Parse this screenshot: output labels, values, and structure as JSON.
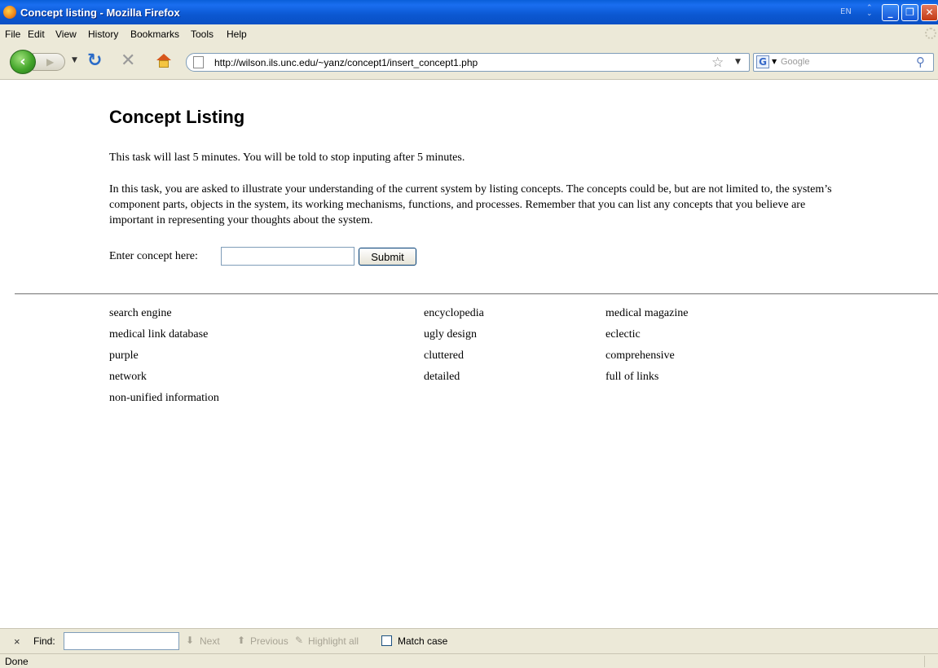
{
  "window": {
    "title": "Concept listing - Mozilla Firefox",
    "lang": "EN"
  },
  "menu": {
    "items": [
      "File",
      "Edit",
      "View",
      "History",
      "Bookmarks",
      "Tools",
      "Help"
    ]
  },
  "nav": {
    "url": "http://wilson.ils.unc.edu/~yanz/concept1/insert_concept1.php",
    "search_placeholder": "Google"
  },
  "page": {
    "heading": "Concept Listing",
    "para1": "This task will last 5 minutes. You will be told to stop inputing after 5 minutes.",
    "para2": "In this task, you are asked to illustrate your understanding of the current system by listing concepts. The concepts could be, but are not limited to, the system’s component parts, objects in the system, its working mechanisms, functions, and processes. Remember that you can list any concepts that you believe are important in representing your thoughts about the system.",
    "form": {
      "label": "Enter concept here:",
      "value": "",
      "submit_label": "Submit"
    },
    "concepts": {
      "col1": [
        "search engine",
        "medical link database",
        "purple",
        "network",
        "non-unified information"
      ],
      "col2": [
        "encyclopedia",
        "ugly design",
        "cluttered",
        "detailed"
      ],
      "col3": [
        "medical magazine",
        "eclectic",
        "comprehensive",
        "full of links"
      ]
    }
  },
  "findbar": {
    "close": "×",
    "label": "Find:",
    "next": "Next",
    "previous": "Previous",
    "highlight": "Highlight all",
    "match_case": "Match case"
  },
  "status": {
    "text": "Done"
  }
}
